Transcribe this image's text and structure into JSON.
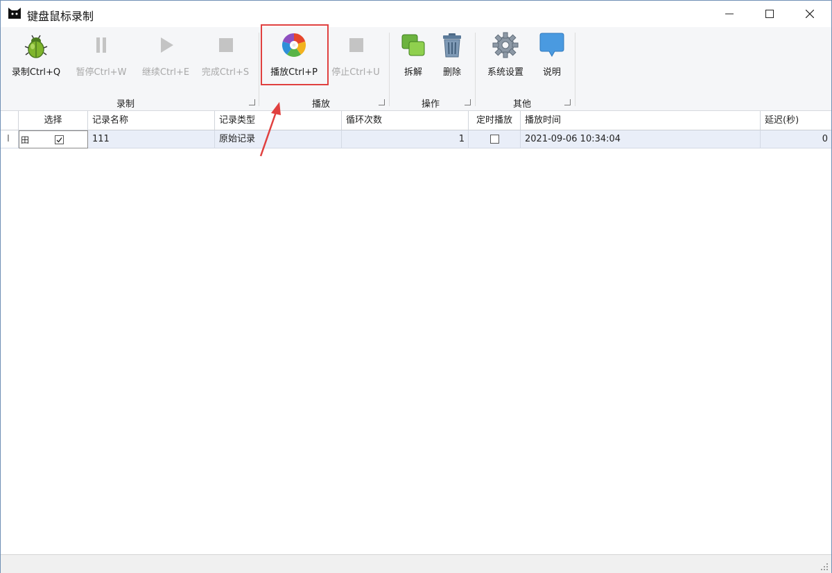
{
  "window": {
    "title": "键盘鼠标录制",
    "controls": [
      "minimize",
      "maximize",
      "close"
    ]
  },
  "ribbon": {
    "groups": [
      {
        "label": "录制",
        "tools": [
          {
            "label": "录制Ctrl+Q",
            "icon": "bug-icon",
            "enabled": true
          },
          {
            "label": "暂停Ctrl+W",
            "icon": "pause-icon",
            "enabled": false
          },
          {
            "label": "继续Ctrl+E",
            "icon": "play-icon",
            "enabled": false
          },
          {
            "label": "完成Ctrl+S",
            "icon": "stop-icon",
            "enabled": false
          }
        ]
      },
      {
        "label": "播放",
        "tools": [
          {
            "label": "播放Ctrl+P",
            "icon": "color-disc-icon",
            "enabled": true
          },
          {
            "label": "停止Ctrl+U",
            "icon": "stop-icon",
            "enabled": false
          }
        ]
      },
      {
        "label": "操作",
        "tools": [
          {
            "label": "拆解",
            "icon": "copy-blocks-icon",
            "enabled": true
          },
          {
            "label": "删除",
            "icon": "trash-icon",
            "enabled": true
          }
        ]
      },
      {
        "label": "其他",
        "tools": [
          {
            "label": "系统设置",
            "icon": "gear-icon",
            "enabled": true
          },
          {
            "label": "说明",
            "icon": "speech-bubble-icon",
            "enabled": true
          }
        ]
      }
    ]
  },
  "grid": {
    "columns": [
      "选择",
      "记录名称",
      "记录类型",
      "循环次数",
      "定时播放",
      "播放时间",
      "延迟(秒)"
    ],
    "rows": [
      {
        "indicator": "I",
        "expand": "田",
        "selected": true,
        "name": "111",
        "type": "原始记录",
        "loops": "1",
        "timed": false,
        "time": "2021-09-06 10:34:04",
        "delay": "0"
      }
    ]
  },
  "colors": {
    "highlight_box": "#e0403f",
    "row_selected": "#e9eef8",
    "annotation_arrow": "#e0403f"
  }
}
